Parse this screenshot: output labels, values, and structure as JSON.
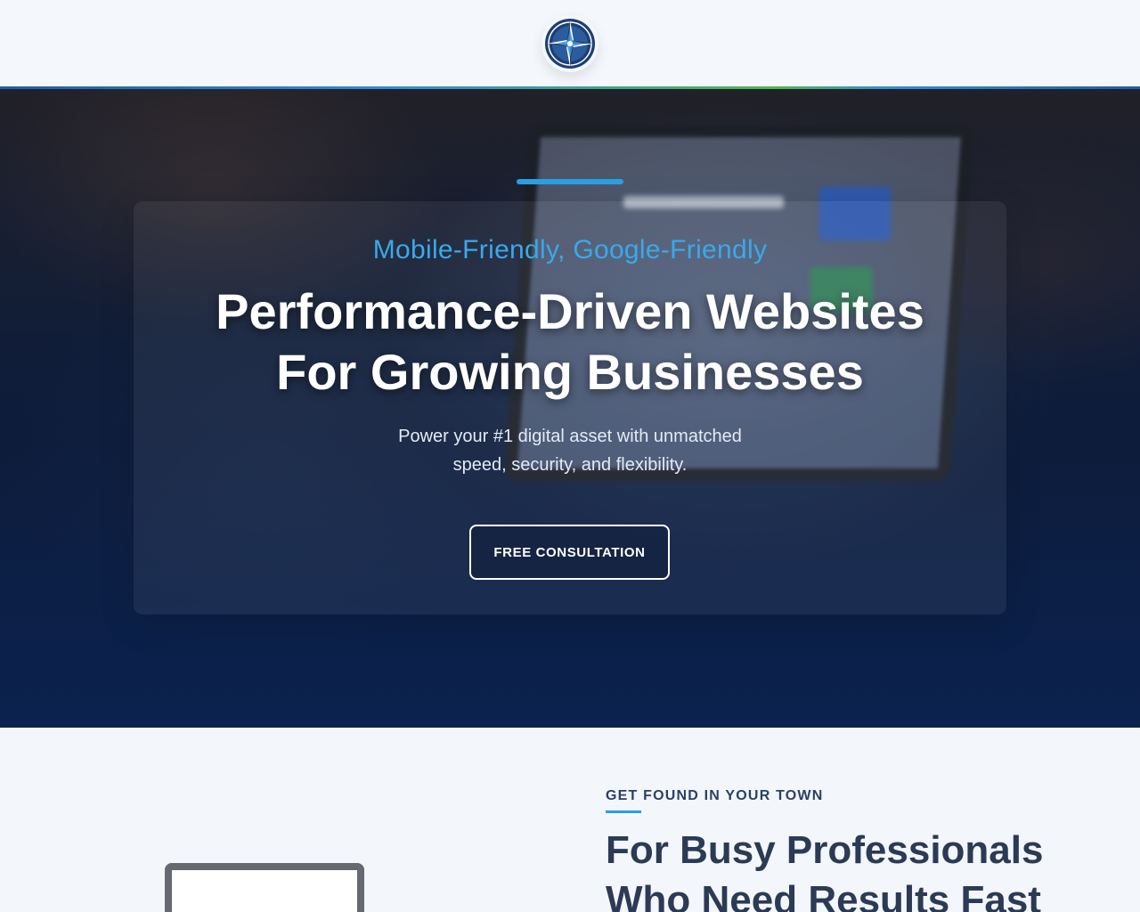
{
  "header": {
    "logo_icon": "compass-rose-icon",
    "rule_colors": [
      "#1f5fa8",
      "#2d8fd5",
      "#4cb84c"
    ]
  },
  "hero": {
    "kicker": "Mobile-Friendly, Google-Friendly",
    "title_line1": "Performance-Driven Websites",
    "title_line2": "For Growing Businesses",
    "subtitle_line1": "Power your #1 digital asset with unmatched",
    "subtitle_line2": "speed, security, and flexibility.",
    "cta_label": "FREE CONSULTATION",
    "accent_color": "#2a9fe0"
  },
  "section": {
    "kicker": "GET FOUND IN YOUR TOWN",
    "title_line1": "For Busy Professionals",
    "title_line2": "Who Need Results Fast"
  }
}
